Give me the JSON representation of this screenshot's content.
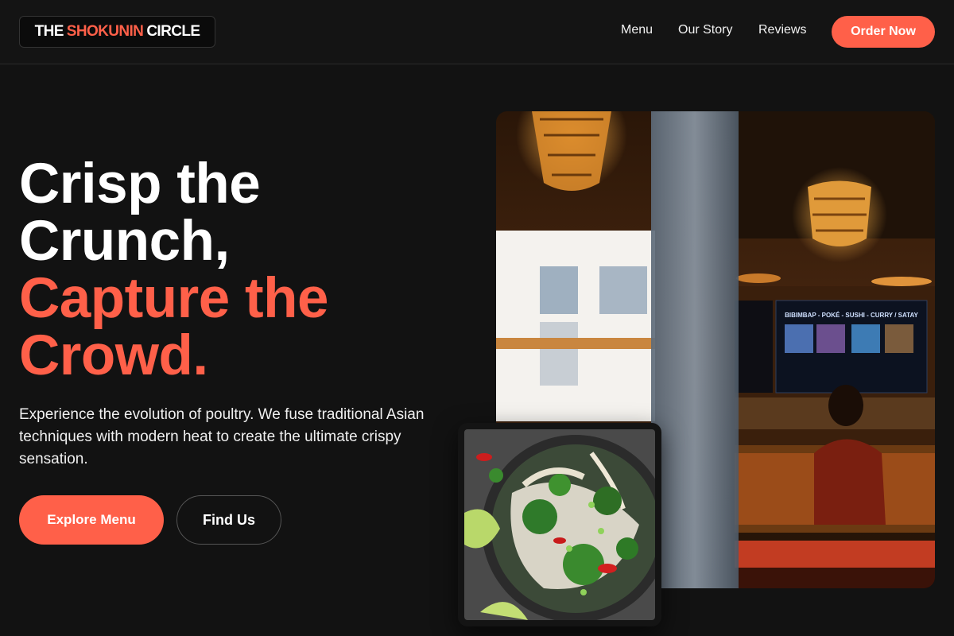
{
  "brand": {
    "prefix": "THE",
    "accent": "SHOKUNIN",
    "suffix": "CIRCLE",
    "accent_color": "#ff6049"
  },
  "nav": {
    "items": [
      "Menu",
      "Our Story",
      "Reviews"
    ],
    "cta": "Order Now"
  },
  "hero": {
    "headline_white": [
      "Crisp the",
      "Crunch,"
    ],
    "headline_accent": [
      "Capture the",
      "Crowd."
    ],
    "subtext": "Experience the evolution of poultry. We fuse traditional Asian techniques with modern heat to create the ultimate crispy sensation.",
    "primary_button": "Explore Menu",
    "secondary_button": "Find Us"
  },
  "images": {
    "main": "restaurant-interior-photo",
    "secondary": "noodle-bowl-photo",
    "menu_board": "BIBIMBAP - POKÉ - SUSHI - CURRY / SATAY"
  }
}
